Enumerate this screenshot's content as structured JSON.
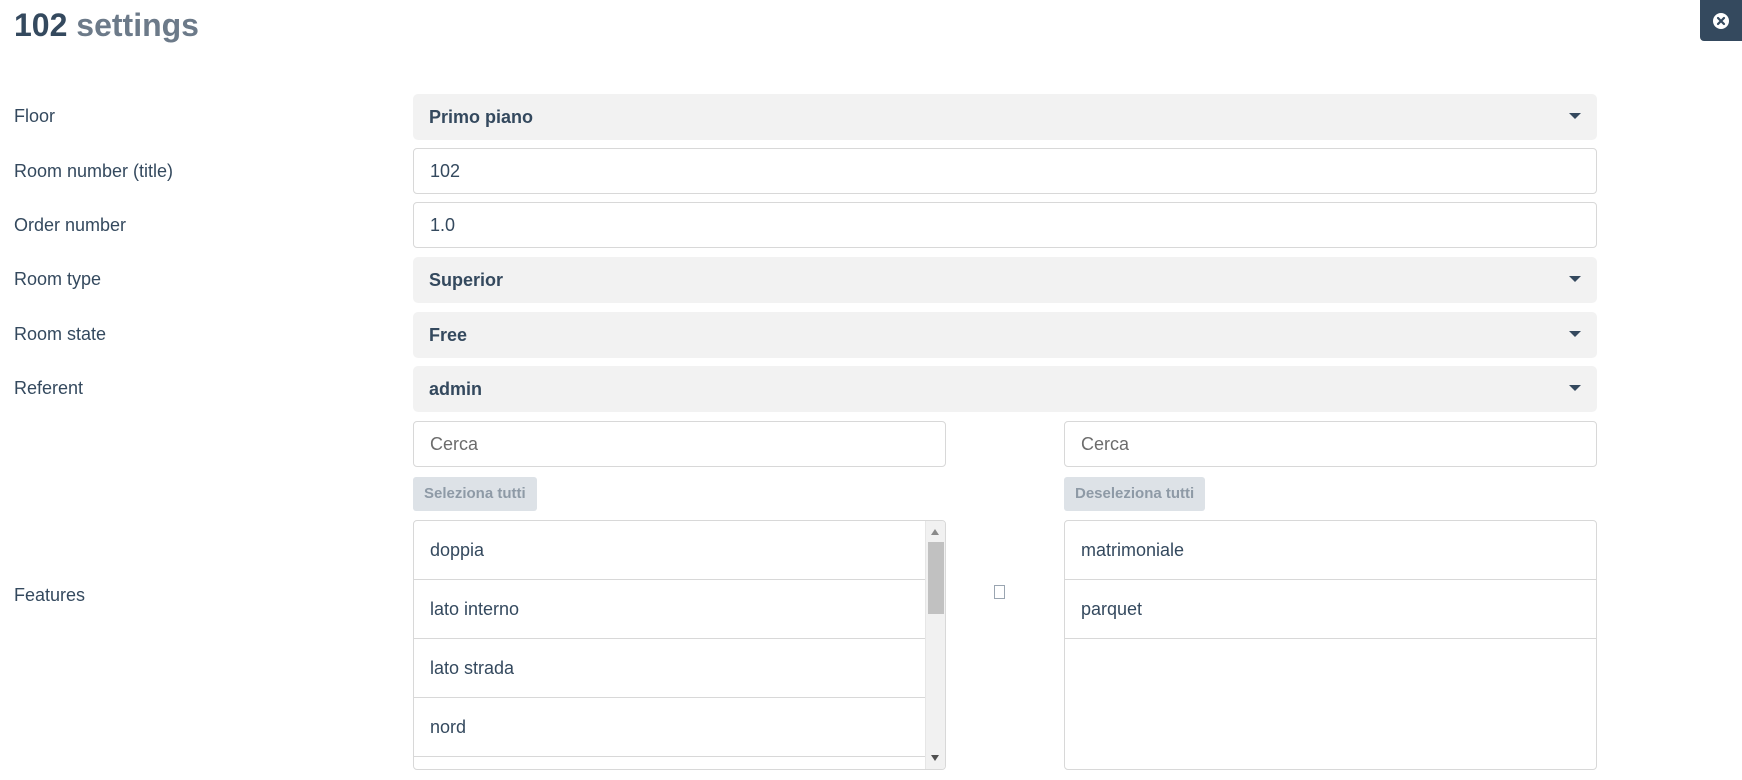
{
  "header": {
    "title_number": "102",
    "title_word": "settings",
    "close_icon": "close-circle-icon"
  },
  "form": {
    "floor": {
      "label": "Floor",
      "value": "Primo piano"
    },
    "room_number": {
      "label": "Room number (title)",
      "value": "102"
    },
    "order_number": {
      "label": "Order number",
      "value": "1.0"
    },
    "room_type": {
      "label": "Room type",
      "value": "Superior"
    },
    "room_state": {
      "label": "Room state",
      "value": "Free"
    },
    "referent": {
      "label": "Referent",
      "value": "admin"
    }
  },
  "features": {
    "label": "Features",
    "left": {
      "search_placeholder": "Cerca",
      "select_all_label": "Seleziona tutti",
      "items": [
        "doppia",
        "lato interno",
        "lato strada",
        "nord"
      ]
    },
    "right": {
      "search_placeholder": "Cerca",
      "deselect_all_label": "Deseleziona tutti",
      "items": [
        "matrimoniale",
        "parquet"
      ]
    },
    "move_icon": "move-icon"
  },
  "colors": {
    "primary": "#34495e",
    "select_bg": "#f2f2f2",
    "button_bg": "#dde2e7"
  }
}
